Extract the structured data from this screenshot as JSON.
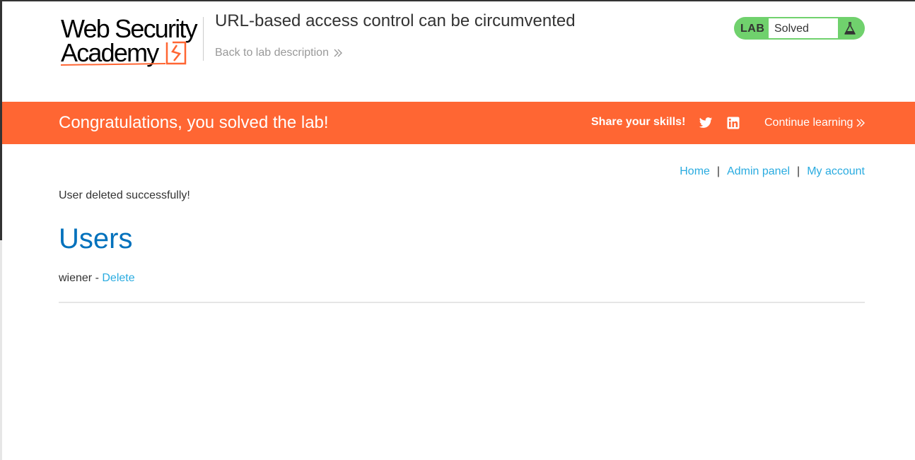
{
  "logo": {
    "line1": "Web Security",
    "line2": "Academy",
    "accent_color": "#ff6633"
  },
  "header": {
    "title": "URL-based access control can be circumvented",
    "back_link": "Back to lab description",
    "back_icon": "double-chevron-right-icon"
  },
  "lab_status": {
    "tag": "LAB",
    "status": "Solved",
    "status_color": "#70d16d",
    "icon": "flask-icon"
  },
  "banner": {
    "message": "Congratulations, you solved the lab!",
    "share_label": "Share your skills!",
    "share_icons": [
      "twitter-icon",
      "linkedin-icon"
    ],
    "continue_label": "Continue learning",
    "background_color": "#ff6633"
  },
  "nav": {
    "home": "Home",
    "admin_panel": "Admin panel",
    "my_account": "My account",
    "separator": "|"
  },
  "notice": "User deleted successfully!",
  "users": {
    "heading": "Users",
    "rows": [
      {
        "username": "wiener",
        "separator": " - ",
        "action": "Delete"
      }
    ]
  }
}
